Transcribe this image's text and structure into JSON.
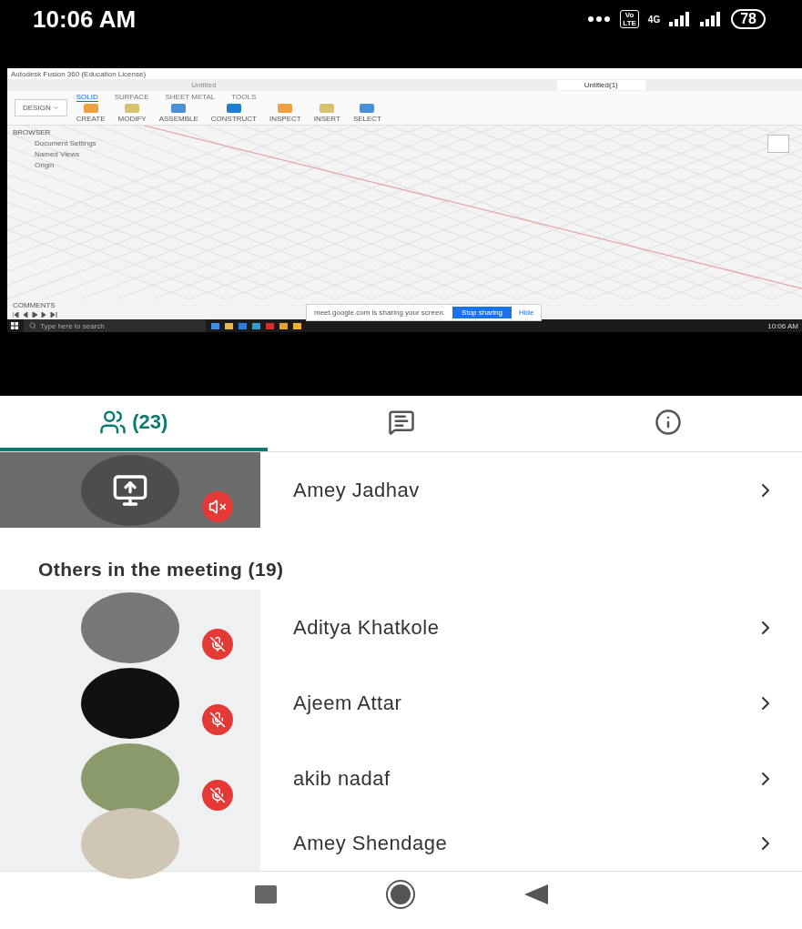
{
  "status_bar": {
    "time": "10:06 AM",
    "volte_top": "Vo",
    "volte_bottom": "LTE",
    "network": "4G",
    "battery": "78"
  },
  "shared_screen": {
    "window_title": "Autodesk Fusion 360 (Education License)",
    "documents": [
      {
        "label": "Untitled",
        "selected": false
      },
      {
        "label": "Untitled(1)",
        "selected": true
      }
    ],
    "workspace": "DESIGN",
    "ribbon_tabs": [
      {
        "label": "SOLID",
        "selected": true
      },
      {
        "label": "SURFACE",
        "selected": false
      },
      {
        "label": "SHEET METAL",
        "selected": false
      },
      {
        "label": "TOOLS",
        "selected": false
      }
    ],
    "tool_groups": [
      "CREATE",
      "MODIFY",
      "ASSEMBLE",
      "CONSTRUCT",
      "INSPECT",
      "INSERT",
      "SELECT"
    ],
    "browser": {
      "title": "BROWSER",
      "items": [
        "Document Settings",
        "Named Views",
        "Origin"
      ]
    },
    "comments": "COMMENTS",
    "share_bar": {
      "message": "meet.google.com is sharing your screen.",
      "stop": "Stop sharing",
      "hide": "Hide"
    },
    "taskbar": {
      "search_placeholder": "Type here to search",
      "time": "10:06 AM"
    }
  },
  "tabs": [
    {
      "kind": "people",
      "label": "(23)",
      "selected": true
    },
    {
      "kind": "chat",
      "selected": false
    },
    {
      "kind": "info",
      "selected": false
    }
  ],
  "presenter": {
    "name": "Amey Jadhav",
    "presenting": true,
    "muted": true
  },
  "section_title": "Others in the meeting (19)",
  "participants": [
    {
      "name": "Aditya Khatkole",
      "muted": true
    },
    {
      "name": "Ajeem Attar",
      "muted": true
    },
    {
      "name": "akib nadaf",
      "muted": true
    },
    {
      "name": "Amey Shendage",
      "muted": false
    }
  ]
}
